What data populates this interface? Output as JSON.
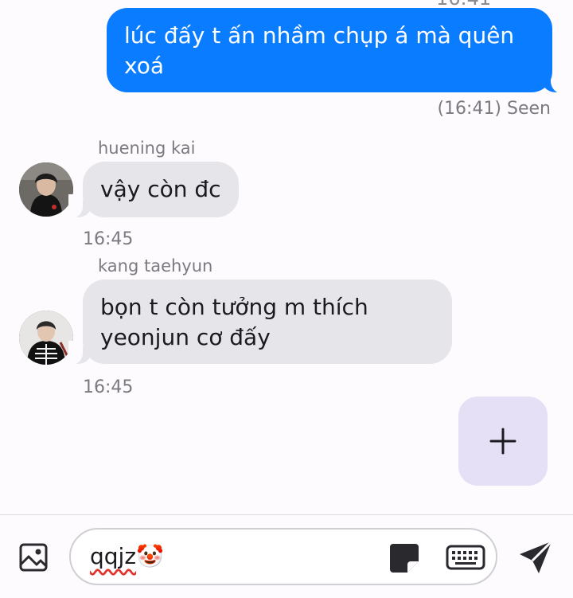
{
  "top_fragment": "16:41",
  "messages": {
    "outgoing": {
      "text": "lúc đấy t ấn nhầm chụp á mà quên xoá",
      "status": "(16:41) Seen"
    },
    "incoming_1": {
      "sender": "huening kai",
      "text": "vậy còn đc",
      "time": "16:45"
    },
    "incoming_2": {
      "sender": "kang taehyun",
      "text": "bọn t còn tưởng m thích yeonjun cơ đấy",
      "time": "16:45"
    }
  },
  "composer": {
    "value": "qqjz",
    "emoji": "🤡"
  },
  "icons": {
    "gallery": "image-icon",
    "add": "plus-icon",
    "sticker": "sticker-icon",
    "keyboard": "keyboard-icon",
    "send": "send-icon"
  },
  "colors": {
    "outgoing_bubble": "#0a7cff",
    "incoming_bubble": "#e5e5ea",
    "fab": "#e6e0f6",
    "background": "#fdfbfe"
  }
}
